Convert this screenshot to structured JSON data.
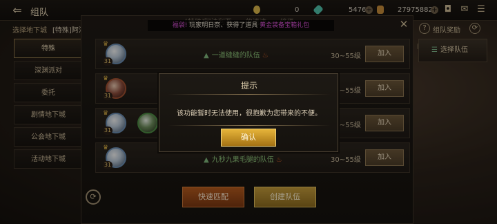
{
  "header": {
    "back_icon": "back-arrow-icon",
    "title": "组队",
    "resources": [
      {
        "name": "gold",
        "value": "0",
        "color": "#d9b54a"
      },
      {
        "name": "gem",
        "value": "5476",
        "color": "#4fbfa8"
      },
      {
        "name": "coin",
        "value": "279758825",
        "color": "#c48a3a"
      }
    ]
  },
  "sidebar": {
    "header": "选择地下城",
    "selected": "[特殊]阿法",
    "items": [
      {
        "label": "特殊",
        "active": true
      },
      {
        "label": "深渊派对",
        "active": false
      },
      {
        "label": "委托",
        "active": false
      },
      {
        "label": "剧情地下城",
        "active": false
      },
      {
        "label": "公会地下城",
        "active": false
      },
      {
        "label": "活动地下城",
        "active": false
      }
    ]
  },
  "right_panel": {
    "help_icon": "help-icon",
    "reward_label": "组队奖励",
    "refresh_icon": "refresh-icon",
    "partial_text": "的队",
    "select_team_label": "选择队伍"
  },
  "panel": {
    "headline": "[特殊]阿法利亚——的遗迹——终焉",
    "announcement": {
      "prefix": "福袋!",
      "middle": "玩家明日奈、获得了道具",
      "item": "黄金装备宝箱礼包"
    },
    "rows": [
      {
        "team_name": "一道缝缝的队伍",
        "level_range": "30~55级",
        "join_label": "加入",
        "level": "31"
      },
      {
        "team_name": "",
        "level_range": "30~55级",
        "join_label": "加入",
        "level": "31"
      },
      {
        "team_name": "",
        "level_range": "30~55级",
        "join_label": "加入",
        "level": "31"
      },
      {
        "team_name": "九秒九果毛腿的队伍",
        "level_range": "30~55级",
        "join_label": "加入",
        "level": "31"
      }
    ],
    "quick_match_label": "快速匹配",
    "create_team_label": "创建队伍"
  },
  "dialog": {
    "title": "提示",
    "message": "该功能暂时无法使用，很抱歉为您带来的不便。",
    "confirm_label": "确认"
  }
}
